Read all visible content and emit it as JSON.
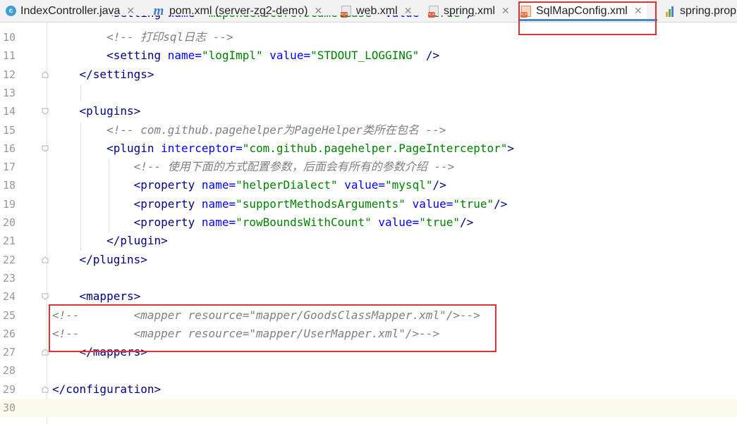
{
  "tabs": [
    {
      "label": "IndexController.java",
      "icon": "java-class-icon",
      "active": false
    },
    {
      "label": "pom.xml (server-zg2-demo)",
      "icon": "maven-icon",
      "active": false
    },
    {
      "label": "web.xml",
      "icon": "xml-file-icon",
      "active": false
    },
    {
      "label": "spring.xml",
      "icon": "xml-file-icon",
      "active": false
    },
    {
      "label": "SqlMapConfig.xml",
      "icon": "xml-file-icon",
      "active": true
    },
    {
      "label": "spring.prop",
      "icon": "properties-file-icon",
      "active": false
    }
  ],
  "editor": {
    "current_line": 30,
    "lines": [
      {
        "n": "10",
        "tokens": [
          [
            "        ",
            "pun"
          ],
          [
            "<!-- 打印sql日志 -->",
            "cmt"
          ]
        ]
      },
      {
        "n": "11",
        "tokens": [
          [
            "        ",
            "pun"
          ],
          [
            "<setting ",
            "tag"
          ],
          [
            "name=",
            "attr"
          ],
          [
            "\"logImpl\"",
            "val"
          ],
          [
            " ",
            "pun"
          ],
          [
            "value=",
            "attr"
          ],
          [
            "\"STDOUT_LOGGING\"",
            "val"
          ],
          [
            " />",
            "tag"
          ]
        ]
      },
      {
        "n": "12",
        "tokens": [
          [
            "    ",
            "pun"
          ],
          [
            "</settings>",
            "tag"
          ]
        ]
      },
      {
        "n": "13",
        "tokens": []
      },
      {
        "n": "14",
        "tokens": [
          [
            "    ",
            "pun"
          ],
          [
            "<plugins>",
            "tag"
          ]
        ]
      },
      {
        "n": "15",
        "tokens": [
          [
            "        ",
            "pun"
          ],
          [
            "<!-- com.github.pagehelper为PageHelper类所在包名 -->",
            "cmt"
          ]
        ]
      },
      {
        "n": "16",
        "tokens": [
          [
            "        ",
            "pun"
          ],
          [
            "<plugin ",
            "tag"
          ],
          [
            "interceptor=",
            "attr"
          ],
          [
            "\"com.github.pagehelper.PageInterceptor\"",
            "val"
          ],
          [
            ">",
            "tag"
          ]
        ]
      },
      {
        "n": "17",
        "tokens": [
          [
            "            ",
            "pun"
          ],
          [
            "<!-- 使用下面的方式配置参数，后面会有所有的参数介绍 -->",
            "cmt"
          ]
        ]
      },
      {
        "n": "18",
        "tokens": [
          [
            "            ",
            "pun"
          ],
          [
            "<property ",
            "tag"
          ],
          [
            "name=",
            "attr"
          ],
          [
            "\"helperDialect\"",
            "val"
          ],
          [
            " ",
            "pun"
          ],
          [
            "value=",
            "attr"
          ],
          [
            "\"mysql\"",
            "val"
          ],
          [
            "/>",
            "tag"
          ]
        ]
      },
      {
        "n": "19",
        "tokens": [
          [
            "            ",
            "pun"
          ],
          [
            "<property ",
            "tag"
          ],
          [
            "name=",
            "attr"
          ],
          [
            "\"supportMethodsArguments\"",
            "val"
          ],
          [
            " ",
            "pun"
          ],
          [
            "value=",
            "attr"
          ],
          [
            "\"true\"",
            "val"
          ],
          [
            "/>",
            "tag"
          ]
        ]
      },
      {
        "n": "20",
        "tokens": [
          [
            "            ",
            "pun"
          ],
          [
            "<property ",
            "tag"
          ],
          [
            "name=",
            "attr"
          ],
          [
            "\"rowBoundsWithCount\"",
            "val"
          ],
          [
            " ",
            "pun"
          ],
          [
            "value=",
            "attr"
          ],
          [
            "\"true\"",
            "val"
          ],
          [
            "/>",
            "tag"
          ]
        ]
      },
      {
        "n": "21",
        "tokens": [
          [
            "        ",
            "pun"
          ],
          [
            "</plugin>",
            "tag"
          ]
        ]
      },
      {
        "n": "22",
        "tokens": [
          [
            "    ",
            "pun"
          ],
          [
            "</plugins>",
            "tag"
          ]
        ]
      },
      {
        "n": "23",
        "tokens": []
      },
      {
        "n": "24",
        "tokens": [
          [
            "    ",
            "pun"
          ],
          [
            "<mappers>",
            "tag"
          ]
        ]
      },
      {
        "n": "25",
        "tokens": [
          [
            "<!--        <mapper resource=\"mapper/GoodsClassMapper.xml\"/>-->",
            "cmt"
          ]
        ]
      },
      {
        "n": "26",
        "tokens": [
          [
            "<!--        <mapper resource=\"mapper/UserMapper.xml\"/>-->",
            "cmt"
          ]
        ]
      },
      {
        "n": "27",
        "tokens": [
          [
            "    ",
            "pun"
          ],
          [
            "</mappers>",
            "tag"
          ]
        ]
      },
      {
        "n": "28",
        "tokens": []
      },
      {
        "n": "29",
        "tokens": [
          [
            "</configuration>",
            "tag"
          ]
        ]
      },
      {
        "n": "30",
        "tokens": []
      }
    ]
  }
}
